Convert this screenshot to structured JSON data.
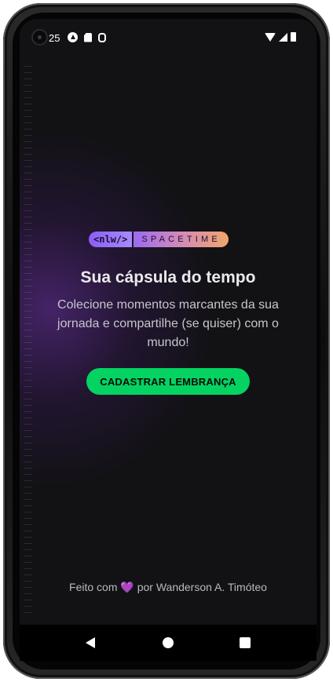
{
  "status_bar": {
    "time": "25",
    "icons_left": [
      "expo-icon",
      "sim-card-icon",
      "debug-icon"
    ],
    "icons_right": [
      "wifi-icon",
      "signal-icon",
      "battery-icon"
    ]
  },
  "logo": {
    "prefix": "<nlw/>",
    "name": "SPACETIME"
  },
  "main": {
    "title": "Sua cápsula do tempo",
    "description": "Colecione momentos marcantes da sua jornada e compartilhe (se quiser) com o mundo!",
    "cta_label": "CADASTRAR LEMBRANÇA"
  },
  "footer": {
    "prefix": "Feito com ",
    "heart": "💜",
    "suffix": " por Wanderson A. Timóteo"
  },
  "nav": {
    "back": "back-icon",
    "home": "home-icon",
    "recent": "recent-apps-icon"
  },
  "colors": {
    "background": "#121215",
    "accent_green": "#04D361",
    "glow_purple": "#6E32AA",
    "text_primary": "#EAEAEA",
    "text_secondary": "#C6C6CC"
  }
}
